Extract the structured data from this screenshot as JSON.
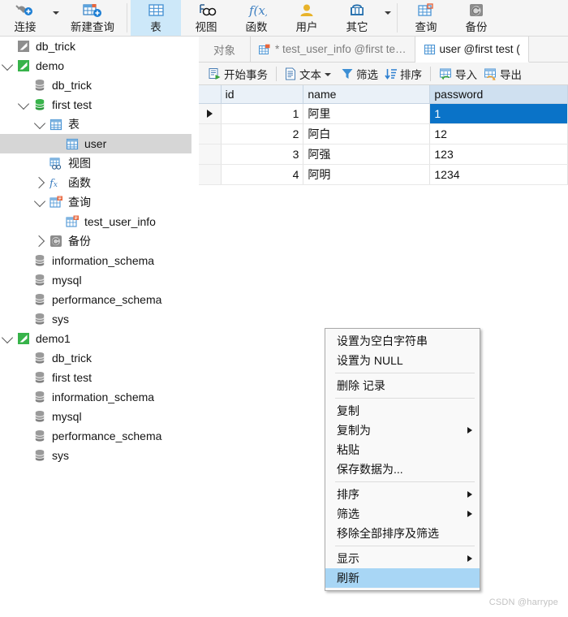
{
  "ribbon": {
    "groups": [
      {
        "items": [
          {
            "label": "连接",
            "icon": "connect-icon",
            "has_caret": false,
            "active": false
          },
          {
            "label": "",
            "icon": "dropdown-caret-icon",
            "standalone_caret": true,
            "active": false
          },
          {
            "label": "新建查询",
            "icon": "new-query-icon",
            "has_caret": false,
            "active": false
          }
        ]
      },
      {
        "items": [
          {
            "label": "表",
            "icon": "table-icon",
            "has_caret": false,
            "active": true
          },
          {
            "label": "视图",
            "icon": "view-icon",
            "has_caret": false,
            "active": false
          },
          {
            "label": "函数",
            "icon": "function-icon",
            "has_caret": false,
            "active": false
          },
          {
            "label": "用户",
            "icon": "user-icon",
            "has_caret": false,
            "active": false
          },
          {
            "label": "其它",
            "icon": "other-icon",
            "has_caret": false,
            "active": false
          },
          {
            "label": "",
            "icon": "dropdown-caret-icon",
            "standalone_caret": true,
            "active": false
          }
        ]
      },
      {
        "items": [
          {
            "label": "查询",
            "icon": "query-icon",
            "has_caret": false,
            "active": false
          },
          {
            "label": "备份",
            "icon": "backup-icon",
            "has_caret": false,
            "active": false
          }
        ]
      }
    ]
  },
  "sidebar": {
    "rows": [
      {
        "label": "db_trick",
        "indent": 0,
        "expander": "none",
        "icon": "connection-gray-icon",
        "selected": false
      },
      {
        "label": "demo",
        "indent": 0,
        "expander": "expanded",
        "icon": "connection-green-icon",
        "selected": false
      },
      {
        "label": "db_trick",
        "indent": 1,
        "expander": "none",
        "icon": "database-gray-icon",
        "selected": false
      },
      {
        "label": "first test",
        "indent": 1,
        "expander": "expanded",
        "icon": "database-green-icon",
        "selected": false
      },
      {
        "label": "表",
        "indent": 2,
        "expander": "expanded",
        "icon": "table-folder-icon",
        "selected": false
      },
      {
        "label": "user",
        "indent": 3,
        "expander": "none",
        "icon": "table-icon",
        "selected": true
      },
      {
        "label": "视图",
        "indent": 2,
        "expander": "none",
        "icon": "view-folder-icon",
        "selected": false
      },
      {
        "label": "函数",
        "indent": 2,
        "expander": "collapsed",
        "icon": "function-folder-icon",
        "selected": false
      },
      {
        "label": "查询",
        "indent": 2,
        "expander": "expanded",
        "icon": "query-folder-icon",
        "selected": false
      },
      {
        "label": "test_user_info",
        "indent": 3,
        "expander": "none",
        "icon": "query-icon",
        "selected": false
      },
      {
        "label": "备份",
        "indent": 2,
        "expander": "collapsed",
        "icon": "backup-folder-icon",
        "selected": false
      },
      {
        "label": "information_schema",
        "indent": 1,
        "expander": "none",
        "icon": "database-gray-icon",
        "selected": false
      },
      {
        "label": "mysql",
        "indent": 1,
        "expander": "none",
        "icon": "database-gray-icon",
        "selected": false
      },
      {
        "label": "performance_schema",
        "indent": 1,
        "expander": "none",
        "icon": "database-gray-icon",
        "selected": false
      },
      {
        "label": "sys",
        "indent": 1,
        "expander": "none",
        "icon": "database-gray-icon",
        "selected": false
      },
      {
        "label": "demo1",
        "indent": 0,
        "expander": "expanded",
        "icon": "connection-green-icon",
        "selected": false
      },
      {
        "label": "db_trick",
        "indent": 1,
        "expander": "none",
        "icon": "database-gray-icon",
        "selected": false
      },
      {
        "label": "first test",
        "indent": 1,
        "expander": "none",
        "icon": "database-gray-icon",
        "selected": false
      },
      {
        "label": "information_schema",
        "indent": 1,
        "expander": "none",
        "icon": "database-gray-icon",
        "selected": false
      },
      {
        "label": "mysql",
        "indent": 1,
        "expander": "none",
        "icon": "database-gray-icon",
        "selected": false
      },
      {
        "label": "performance_schema",
        "indent": 1,
        "expander": "none",
        "icon": "database-gray-icon",
        "selected": false
      },
      {
        "label": "sys",
        "indent": 1,
        "expander": "none",
        "icon": "database-gray-icon",
        "selected": false
      }
    ]
  },
  "tabs": [
    {
      "label": "对象",
      "icon": "none",
      "active": false
    },
    {
      "label": "* test_user_info @first te…",
      "icon": "query-icon",
      "active": false
    },
    {
      "label": "user @first test (",
      "icon": "table-icon",
      "active": true
    }
  ],
  "grid_toolbar": {
    "items": [
      {
        "label": "开始事务",
        "icon": "begin-transaction-icon",
        "caret": false
      },
      {
        "sep": true
      },
      {
        "label": "文本",
        "icon": "text-icon",
        "caret": true
      },
      {
        "label": "筛选",
        "icon": "filter-icon",
        "caret": false
      },
      {
        "label": "排序",
        "icon": "sort-icon",
        "caret": false
      },
      {
        "sep": true
      },
      {
        "label": "导入",
        "icon": "import-icon",
        "caret": false
      },
      {
        "label": "导出",
        "icon": "export-icon",
        "caret": false
      }
    ]
  },
  "datagrid": {
    "columns": [
      "id",
      "name",
      "password"
    ],
    "active_column": "password",
    "rows": [
      {
        "current": true,
        "id": "1",
        "name": "阿里",
        "password": "1",
        "selected_cell": "password"
      },
      {
        "current": false,
        "id": "2",
        "name": "阿白",
        "password": "12",
        "selected_cell": ""
      },
      {
        "current": false,
        "id": "3",
        "name": "阿强",
        "password": "123",
        "selected_cell": ""
      },
      {
        "current": false,
        "id": "4",
        "name": "阿明",
        "password": "1234",
        "selected_cell": ""
      }
    ]
  },
  "context_menu": {
    "items": [
      {
        "label": "设置为空白字符串",
        "submenu": false,
        "highlight": false
      },
      {
        "label": "设置为 NULL",
        "submenu": false,
        "highlight": false
      },
      {
        "sep": true
      },
      {
        "label": "删除 记录",
        "submenu": false,
        "highlight": false
      },
      {
        "sep": true
      },
      {
        "label": "复制",
        "submenu": false,
        "highlight": false
      },
      {
        "label": "复制为",
        "submenu": true,
        "highlight": false
      },
      {
        "label": "粘贴",
        "submenu": false,
        "highlight": false
      },
      {
        "label": "保存数据为...",
        "submenu": false,
        "highlight": false
      },
      {
        "sep": true
      },
      {
        "label": "排序",
        "submenu": true,
        "highlight": false
      },
      {
        "label": "筛选",
        "submenu": true,
        "highlight": false
      },
      {
        "label": "移除全部排序及筛选",
        "submenu": false,
        "highlight": false
      },
      {
        "sep": true
      },
      {
        "label": "显示",
        "submenu": true,
        "highlight": false
      },
      {
        "label": "刷新",
        "submenu": false,
        "highlight": true
      }
    ]
  },
  "watermark": {
    "text": "CSDN @harrype"
  },
  "colors": {
    "accent_blue": "#0a73c8",
    "ribbon_active": "#cde8f9",
    "menu_highlight": "#a8d6f5",
    "tree_selected": "#d6d6d6",
    "header_bg": "#eaf1f8"
  }
}
